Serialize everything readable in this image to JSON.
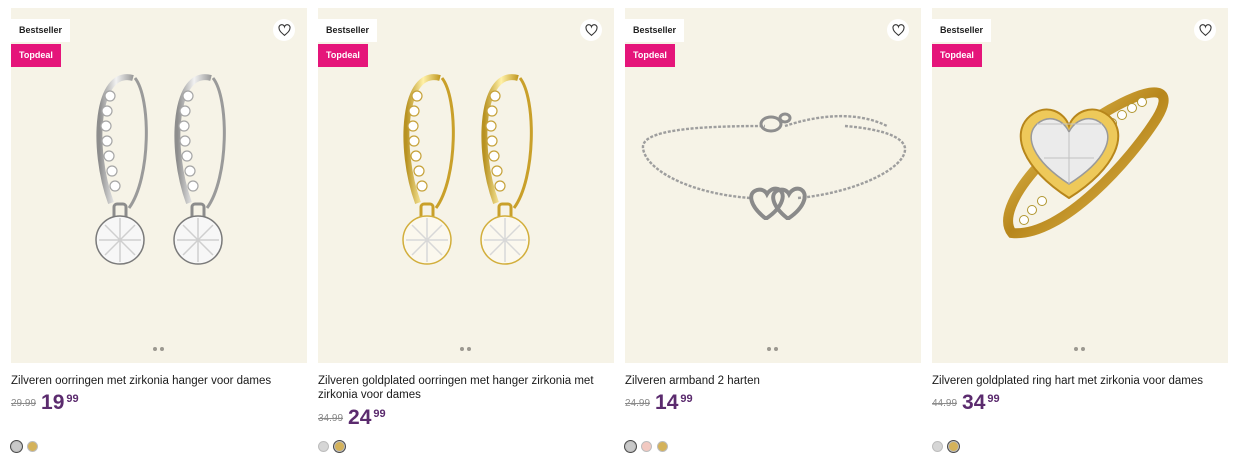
{
  "products": [
    {
      "badge_bestseller": "Bestseller",
      "badge_deal": "Topdeal",
      "title": "Zilveren oorringen met zirkonia hanger voor dames",
      "old_price": "29.99",
      "price_main": "19",
      "price_cents": "99",
      "image_icon": "silver-drop-earrings",
      "swatches": [
        "#c9c9c9",
        "#d4b25a"
      ]
    },
    {
      "badge_bestseller": "Bestseller",
      "badge_deal": "Topdeal",
      "title": "Zilveren goldplated oorringen met hanger zirkonia met zirkonia voor dames",
      "old_price": "34.99",
      "price_main": "24",
      "price_cents": "99",
      "image_icon": "gold-drop-earrings",
      "swatches": [
        "#d6d6d6",
        "#d4b25a"
      ]
    },
    {
      "badge_bestseller": "Bestseller",
      "badge_deal": "Topdeal",
      "title": "Zilveren armband 2 harten",
      "old_price": "24.99",
      "price_main": "14",
      "price_cents": "99",
      "image_icon": "double-heart-bracelet",
      "swatches": [
        "#c9c9c9",
        "#f2c9c1",
        "#d4b25a"
      ]
    },
    {
      "badge_bestseller": "Bestseller",
      "badge_deal": "Topdeal",
      "title": "Zilveren goldplated ring hart met zirkonia voor dames",
      "old_price": "44.99",
      "price_main": "34",
      "price_cents": "99",
      "image_icon": "gold-heart-ring",
      "swatches": [
        "#d6d6d6",
        "#d4b25a"
      ]
    }
  ],
  "colors": {
    "card_background": "#f6f3e7",
    "deal_badge": "#e5157a",
    "price": "#5b2b6e"
  },
  "icons": {
    "wishlist": "heart-outline-icon"
  }
}
